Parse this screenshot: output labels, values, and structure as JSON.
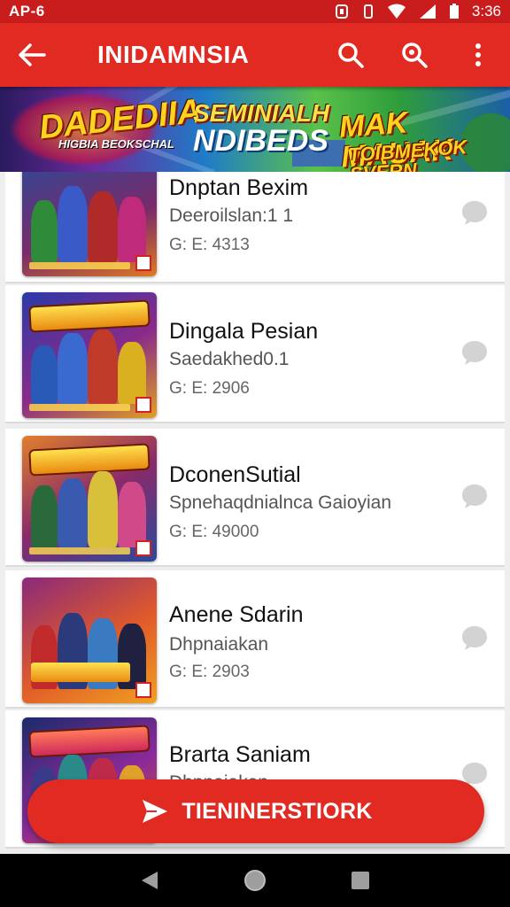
{
  "statusbar": {
    "time_left": "AP-6",
    "clock": "3:36"
  },
  "appbar": {
    "title": "INIDAMNSIA"
  },
  "banner": {
    "title_left": "DADEDIIA",
    "subtitle_left": "HIGBIA BEOKSCHAL",
    "title_mid_top": "SEMINIALH",
    "title_mid_bottom": "NDIBEDS",
    "title_right": "MAK MAUAK",
    "subtitle_right": "TOIBMEKOK SVERN"
  },
  "items": [
    {
      "title": "Dnptan Bexim",
      "subtitle": "Deeroilslan:1 1",
      "meta": "G: E: 4313"
    },
    {
      "title": "Dingala Pesian",
      "subtitle": "Saedakhed0.1",
      "meta": "G: E: 2906"
    },
    {
      "title": "DconenSutial",
      "subtitle": "Spnehaqdnialnca Gaioyian",
      "meta": "G: E: 49000"
    },
    {
      "title": "Anene Sdarin",
      "subtitle": "Dhpnaiakan",
      "meta": "G: E: 2903"
    },
    {
      "title": "Brarta Saniam",
      "subtitle": "Dhpnaiakan",
      "meta": ""
    }
  ],
  "fab": {
    "label": "TIENINERSTIORK"
  },
  "colors": {
    "primary": "#e02a22",
    "status": "#c91d1d"
  }
}
